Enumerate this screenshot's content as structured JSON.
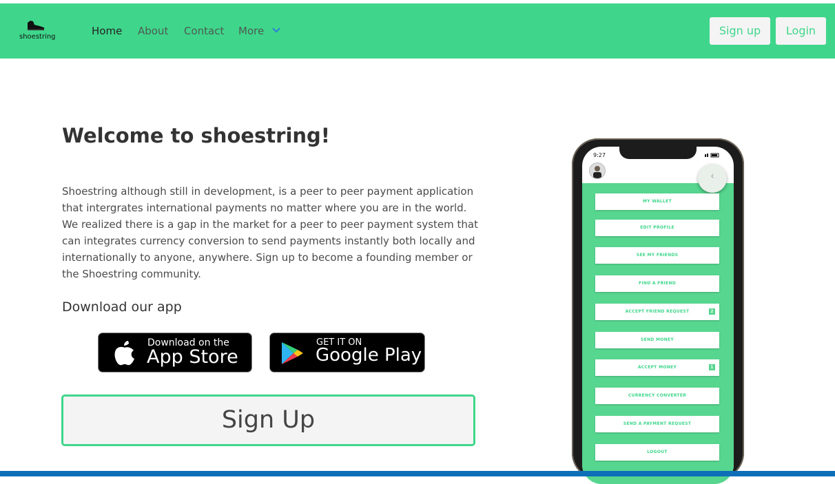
{
  "navbar": {
    "logo_text": "shoestring",
    "links": [
      {
        "label": "Home",
        "active": true
      },
      {
        "label": "About"
      },
      {
        "label": "Contact"
      },
      {
        "label": "More"
      }
    ],
    "signup_label": "Sign up",
    "login_label": "Login",
    "accent": "#3fd68b"
  },
  "hero": {
    "title": "Welcome to shoestring!",
    "description": "Shoestring although still in development, is a peer to peer payment application that intergrates international payments no matter where you are in the world. We realized there is a gap in the market for a peer to peer payment system that can integrates currency conversion to send payments instantly both locally and internationally to anyone, anywhere. Sign up to become a founding member or the Shoestring community.",
    "download_title": "Download our app",
    "app_store": {
      "small": "Download on the",
      "big": "App Store"
    },
    "google_play": {
      "small": "GET IT ON",
      "big": "Google Play"
    },
    "signup_button": "Sign Up"
  },
  "phone": {
    "time": "9:27",
    "menu": [
      {
        "label": "MY WALLET"
      },
      {
        "label": "EDIT PROFILE"
      },
      {
        "label": "SEE MY FRIENDS"
      },
      {
        "label": "FIND A FRIEND"
      },
      {
        "label": "ACCEPT FRIEND REQUEST",
        "badge": "2"
      },
      {
        "label": "SEND MONEY"
      },
      {
        "label": "ACCEPT MONEY",
        "badge": "1"
      },
      {
        "label": "CURRENCY CONVERTER"
      },
      {
        "label": "SEND A PAYMENT REQUEST"
      },
      {
        "label": "LOGOUT"
      }
    ]
  }
}
